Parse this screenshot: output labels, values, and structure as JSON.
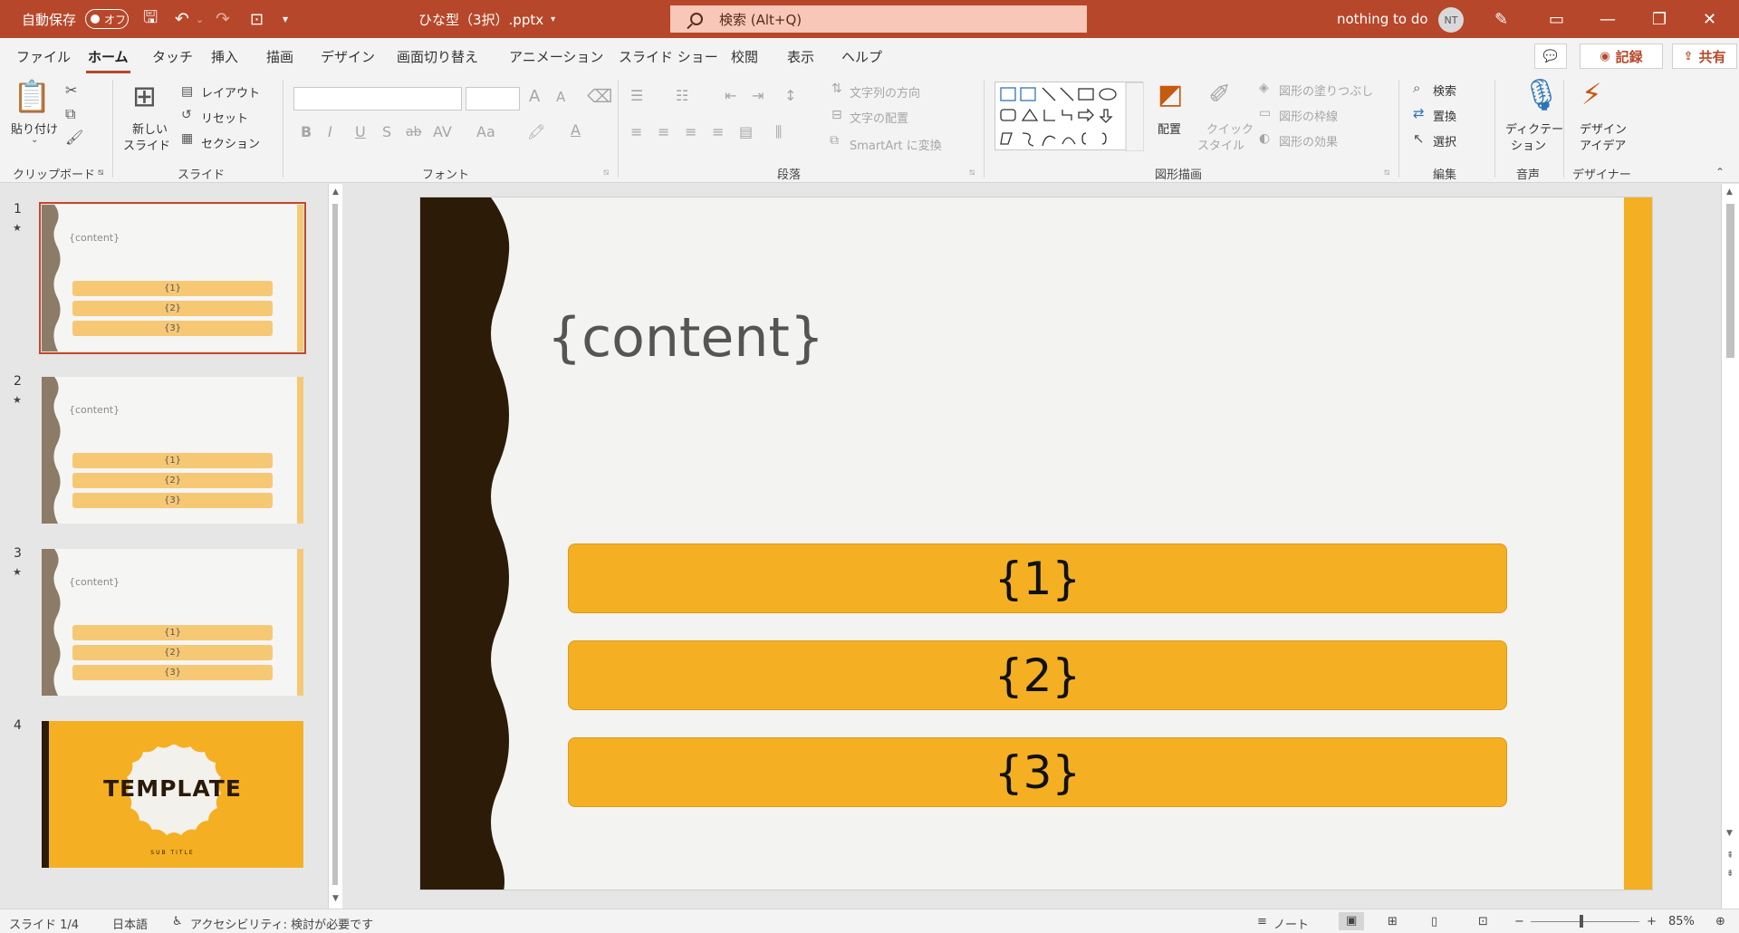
{
  "titlebar": {
    "autosave_label": "自動保存",
    "autosave_state": "オフ",
    "doc_title": "ひな型（3択）.pptx",
    "search_text": "検索 (Alt+Q)",
    "user_name": "nothing to do",
    "user_initials": "NT",
    "minimize": "—",
    "restore": "❐",
    "close": "✕"
  },
  "menu": {
    "tabs": [
      "ファイル",
      "ホーム",
      "タッチ",
      "挿入",
      "描画",
      "デザイン",
      "画面切り替え",
      "アニメーション",
      "スライド ショー",
      "校閲",
      "表示",
      "ヘルプ"
    ],
    "record": "記録",
    "share": "共有",
    "comment_icon": "💬"
  },
  "ribbon": {
    "clipboard": {
      "paste": "貼り付け",
      "group": "クリップボード"
    },
    "slides": {
      "new_slide_1": "新しい",
      "new_slide_2": "スライド",
      "layout": "レイアウト",
      "reset": "リセット",
      "section": "セクション",
      "group": "スライド"
    },
    "font": {
      "group": "フォント",
      "bold": "B",
      "italic": "I",
      "underline": "U",
      "shadow": "S",
      "strike": "ab",
      "spacing": "AV",
      "case": "Aa",
      "grow": "A",
      "shrink": "A"
    },
    "paragraph": {
      "group": "段落",
      "text_direction": "文字列の方向",
      "align_text": "文字の配置",
      "smartart": "SmartArt に変換"
    },
    "drawing": {
      "group": "図形描画",
      "arrange": "配置",
      "quick_1": "クイック",
      "quick_2": "スタイル",
      "fill": "図形の塗りつぶし",
      "outline": "図形の枠線",
      "effects": "図形の効果"
    },
    "editing": {
      "group": "編集",
      "find": "検索",
      "replace": "置換",
      "select": "選択"
    },
    "voice": {
      "group": "音声",
      "dictate_1": "ディクテー",
      "dictate_2": "ション"
    },
    "designer": {
      "group": "デザイナー",
      "design_1": "デザイン",
      "design_2": "アイデア"
    }
  },
  "thumbnails": [
    {
      "num": "1",
      "content": "{content}",
      "options": [
        "{1}",
        "{2}",
        "{3}"
      ]
    },
    {
      "num": "2",
      "content": "{content}",
      "options": [
        "{1}",
        "{2}",
        "{3}"
      ]
    },
    {
      "num": "3",
      "content": "{content}",
      "options": [
        "{1}",
        "{2}",
        "{3}"
      ]
    },
    {
      "num": "4",
      "title": "TEMPLATE",
      "subtitle": "SUB TITLE"
    }
  ],
  "slide": {
    "title": "{content}",
    "options": [
      "{1}",
      "{2}",
      "{3}"
    ]
  },
  "status": {
    "slide_info": "スライド 1/4",
    "language": "日本語",
    "accessibility": "アクセシビリティ: 検討が必要です",
    "notes": "ノート",
    "zoom": "85%"
  },
  "colors": {
    "brand": "#b7472a",
    "slide_orange": "#f4b022",
    "slide_dark": "#2c1b07"
  }
}
